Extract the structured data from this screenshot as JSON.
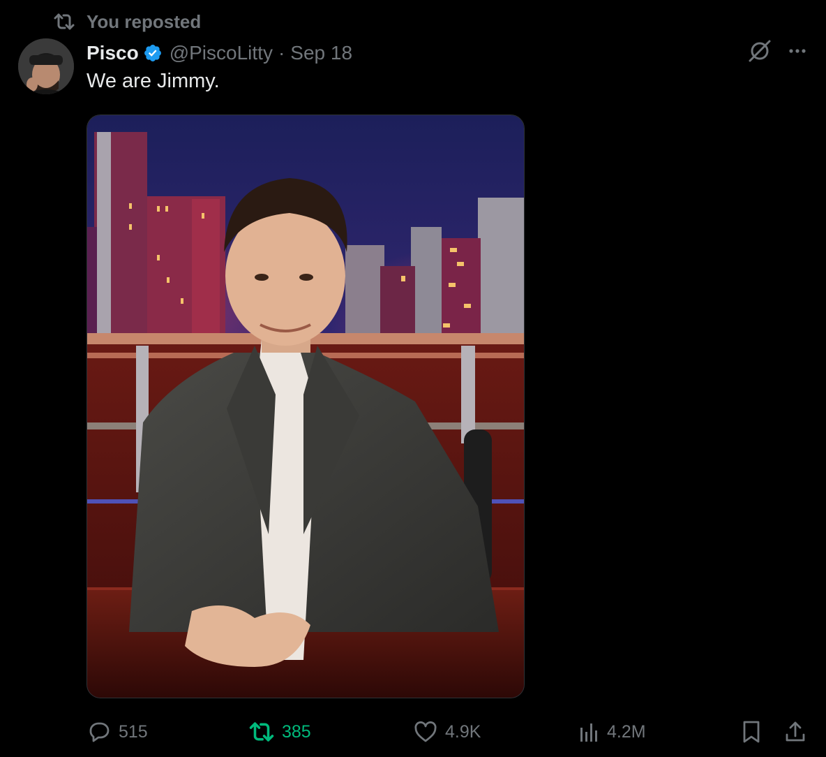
{
  "repost_banner": {
    "text": "You reposted",
    "icon": "repost-icon"
  },
  "tweet": {
    "author": {
      "name": "Pisco",
      "handle": "@PiscoLitty",
      "verified": true,
      "verified_color": "#1d9bf0"
    },
    "separator": "·",
    "date": "Sep 18",
    "text": "We are Jimmy.",
    "media": {
      "kind": "photo"
    },
    "actions": {
      "replies": "515",
      "reposts": "385",
      "likes": "4.9K",
      "views": "4.2M"
    },
    "reposted_by_you": true
  },
  "colors": {
    "background": "#000000",
    "text_primary": "#e7e9ea",
    "text_secondary": "#71767b",
    "repost_active": "#00ba7c",
    "verified": "#1d9bf0"
  },
  "icons": {
    "header": [
      "grok-icon",
      "more-icon"
    ],
    "action_bar": [
      "reply-icon",
      "repost-icon",
      "like-icon",
      "views-icon",
      "bookmark-icon",
      "share-icon"
    ]
  }
}
